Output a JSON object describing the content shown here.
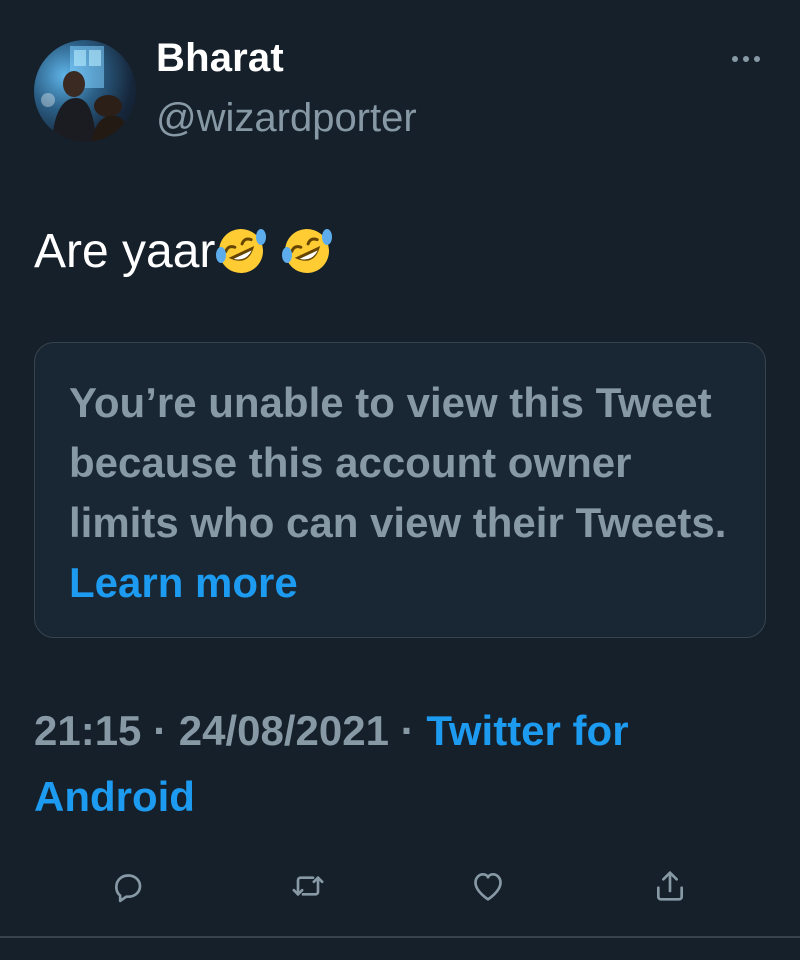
{
  "author": {
    "display_name": "Bharat",
    "handle": "@wizardporter"
  },
  "header": {
    "more_icon": "more-horizontal-icon"
  },
  "tweet": {
    "text": "Are yaar",
    "emojis": [
      "rolling-on-the-floor-laughing-emoji",
      "rolling-on-the-floor-laughing-emoji"
    ]
  },
  "unavailable_notice": {
    "message": "You’re unable to view this Tweet because this account owner limits who can view their Tweets.",
    "learn_more_label": "Learn more"
  },
  "meta": {
    "time": "21:15",
    "separator": "·",
    "date": "24/08/2021",
    "source": "Twitter for Android"
  },
  "actions": [
    {
      "name": "reply",
      "icon": "reply-icon"
    },
    {
      "name": "retweet",
      "icon": "retweet-icon"
    },
    {
      "name": "like",
      "icon": "heart-icon"
    },
    {
      "name": "share",
      "icon": "share-icon"
    }
  ],
  "colors": {
    "background": "#15202b",
    "secondary_text": "#8899a6",
    "link": "#1d9bf0",
    "border": "#38444d"
  }
}
